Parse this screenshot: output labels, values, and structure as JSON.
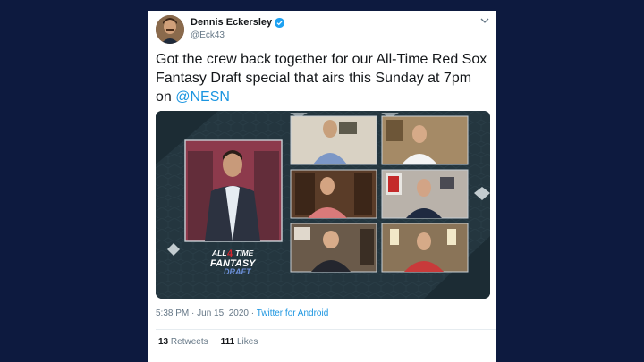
{
  "tweet": {
    "author_name": "Dennis Eckersley",
    "author_handle": "@Eck43",
    "text_before": "Got the crew back together for our All-Time Red Sox Fantasy Draft special that airs this Sunday at 7pm on ",
    "mention": "@NESN",
    "time": "5:38 PM",
    "date": "Jun 15, 2020",
    "source": "Twitter for Android",
    "retweets_count": "13",
    "retweets_label": "Retweets",
    "likes_count": "111",
    "likes_label": "Likes"
  },
  "media": {
    "logo_line1": "ALL",
    "logo_number": "4",
    "logo_line1b": "TIME",
    "logo_line2": "FANTASY",
    "logo_line3": "DRAFT"
  },
  "colors": {
    "page_bg": "#0d1a3f",
    "link": "#1b95e0",
    "verified": "#1da1f2",
    "media_bg": "#24363f"
  },
  "icons": [
    "verified-badge-icon",
    "chevron-down-icon"
  ]
}
